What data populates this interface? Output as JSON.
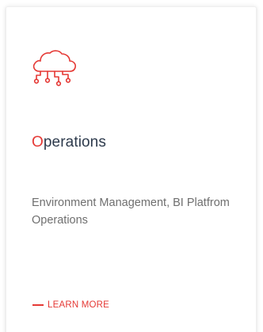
{
  "card": {
    "icon": "cloud-network-icon",
    "title_first_letter": "O",
    "title_rest": "perations",
    "description": "Environment Management, BI Platfrom Operations",
    "link_label": "LEARN MORE"
  },
  "colors": {
    "accent": "#e53935",
    "title": "#2d3a4c",
    "text": "#6f6f6f",
    "background": "#ffffff"
  }
}
